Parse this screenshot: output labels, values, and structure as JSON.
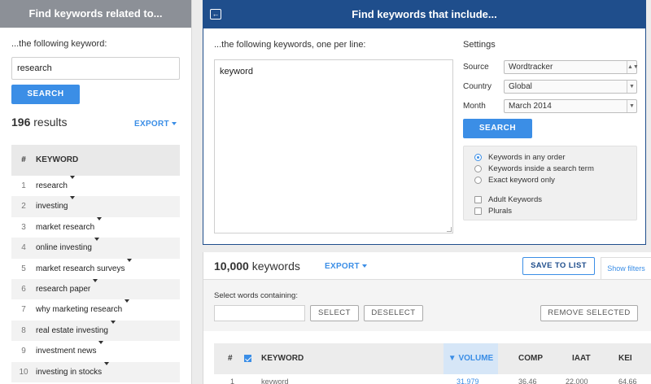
{
  "left_panel": {
    "title": "Find keywords related to...",
    "subtitle": "...the following keyword:",
    "input_value": "research",
    "search_label": "SEARCH",
    "results_count": "196",
    "results_label": "results",
    "export_label": "EXPORT",
    "table": {
      "col_num": "#",
      "col_keyword": "KEYWORD",
      "rows": [
        {
          "n": "1",
          "keyword": "research"
        },
        {
          "n": "2",
          "keyword": "investing"
        },
        {
          "n": "3",
          "keyword": "market research"
        },
        {
          "n": "4",
          "keyword": "online investing"
        },
        {
          "n": "5",
          "keyword": "market research surveys"
        },
        {
          "n": "6",
          "keyword": "research paper"
        },
        {
          "n": "7",
          "keyword": "why marketing research"
        },
        {
          "n": "8",
          "keyword": "real estate investing"
        },
        {
          "n": "9",
          "keyword": "investment news"
        },
        {
          "n": "10",
          "keyword": "investing in stocks"
        }
      ]
    }
  },
  "include_card": {
    "back_icon": "←",
    "title": "Find keywords that include...",
    "subtitle": "...the following keywords, one per line:",
    "textarea_value": "keyword",
    "settings": {
      "title": "Settings",
      "source_label": "Source",
      "source_value": "Wordtracker",
      "country_label": "Country",
      "country_value": "Global",
      "month_label": "Month",
      "month_value": "March 2014"
    },
    "search_label": "SEARCH",
    "options": {
      "order_any": "Keywords in any order",
      "inside_term": "Keywords inside a search term",
      "exact": "Exact keyword only",
      "adult": "Adult Keywords",
      "plurals": "Plurals"
    }
  },
  "results_panel": {
    "count": "10,000",
    "count_label": "keywords",
    "export_label": "EXPORT",
    "save_label": "SAVE TO LIST",
    "show_filters": "Show filters",
    "select_label": "Select words containing:",
    "select_button": "SELECT",
    "deselect_button": "DESELECT",
    "remove_button": "REMOVE SELECTED",
    "table": {
      "col_num": "#",
      "col_keyword": "KEYWORD",
      "col_volume": "VOLUME",
      "col_comp": "COMP",
      "col_iaat": "IAAT",
      "col_kei": "KEI",
      "first_row": {
        "n": "1",
        "keyword": "keyword",
        "volume": "31,979",
        "comp": "36.46",
        "iaat": "22,000",
        "kei": "64.66"
      }
    }
  },
  "colors": {
    "accent": "#3b8ee6",
    "header_dark": "#1f4e8c",
    "header_grey": "#8c9097"
  }
}
